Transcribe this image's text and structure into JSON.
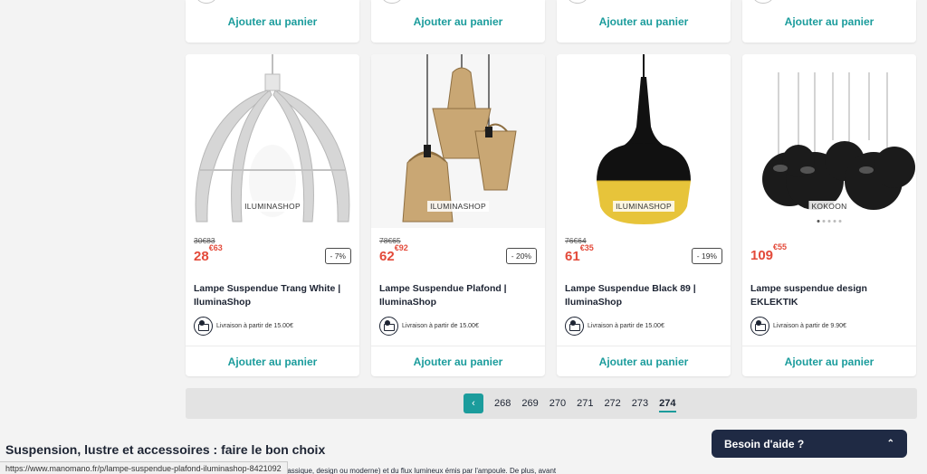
{
  "top_row": {
    "cart_labels": [
      "Ajouter au panier",
      "Ajouter au panier",
      "Ajouter au panier",
      "Ajouter au panier"
    ]
  },
  "products": [
    {
      "seller": "ILUMINASHOP",
      "old_price": "30€83",
      "price_int": "28",
      "price_dec": "€63",
      "discount": "- 7%",
      "title": "Lampe Suspendue Trang White | IluminaShop",
      "delivery": "Livraison à partir de 15.00€",
      "cart": "Ajouter au panier"
    },
    {
      "seller": "ILUMINASHOP",
      "old_price": "78€65",
      "price_int": "62",
      "price_dec": "€92",
      "discount": "- 20%",
      "title": "Lampe Suspendue Plafond | IluminaShop",
      "delivery": "Livraison à partir de 15.00€",
      "cart": "Ajouter au panier"
    },
    {
      "seller": "ILUMINASHOP",
      "old_price": "76€64",
      "price_int": "61",
      "price_dec": "€35",
      "discount": "- 19%",
      "title": "Lampe Suspendue Black 89 | IluminaShop",
      "delivery": "Livraison à partir de 15.00€",
      "cart": "Ajouter au panier"
    },
    {
      "seller": "KOKOON",
      "old_price": "",
      "price_int": "109",
      "price_dec": "€55",
      "discount": "",
      "title": "Lampe suspendue design EKLEKTIK",
      "delivery": "Livraison à partir de 9.90€",
      "cart": "Ajouter au panier"
    }
  ],
  "pagination": {
    "prev_icon": "chevron-left-icon",
    "prev_glyph": "‹",
    "pages": [
      "268",
      "269",
      "270",
      "271",
      "272",
      "273",
      "274"
    ],
    "active": "274"
  },
  "section": {
    "title": "Suspension, lustre et accessoires : faire le bon choix",
    "text": "...age souhaité (direct ou indirect, d'ambiance, fonctionnel ou diffus), de la décoration (classique, design ou moderne) et du flux lumineux émis par l'ampoule. De plus, avant"
  },
  "status_url": "https://www.manomano.fr/p/lampe-suspendue-plafond-iluminashop-8421092",
  "help": {
    "label": "Besoin d'aide ?",
    "chevron": "⌃"
  },
  "colors": {
    "accent": "#1b9c9c",
    "price": "#e34a3a",
    "help_bg": "#1f2a44"
  }
}
